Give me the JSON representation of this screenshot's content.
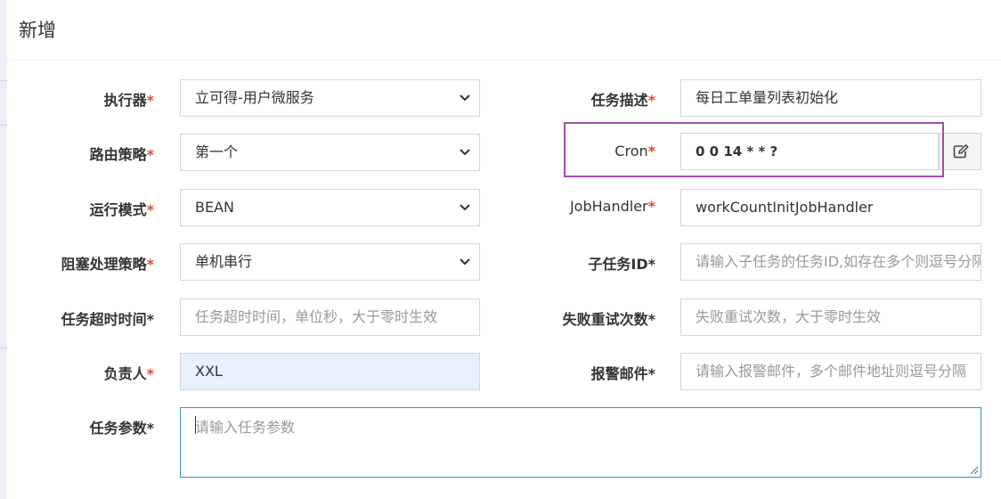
{
  "modal": {
    "title": "新增"
  },
  "form": {
    "executor": {
      "label": "执行器",
      "value": "立可得-用户微服务"
    },
    "route_strategy": {
      "label": "路由策略",
      "value": "第一个"
    },
    "run_mode": {
      "label": "运行模式",
      "value": "BEAN"
    },
    "block_strategy": {
      "label": "阻塞处理策略",
      "value": "单机串行"
    },
    "timeout": {
      "label": "任务超时时间",
      "placeholder": "任务超时时间，单位秒，大于零时生效"
    },
    "owner": {
      "label": "负责人",
      "value": "XXL"
    },
    "task_desc": {
      "label": "任务描述",
      "value": "每日工单量列表初始化"
    },
    "cron": {
      "label": "Cron",
      "value": "0 0 14 * * ?"
    },
    "job_handler": {
      "label": "JobHandler",
      "value": "workCountInitJobHandler"
    },
    "child_job_id": {
      "label": "子任务ID",
      "placeholder": "请输入子任务的任务ID,如存在多个则逗号分隔"
    },
    "retry_count": {
      "label": "失败重试次数",
      "placeholder": "失败重试次数，大于零时生效"
    },
    "alarm_email": {
      "label": "报警邮件",
      "placeholder": "请输入报警邮件，多个邮件地址则逗号分隔"
    },
    "task_param": {
      "label": "任务参数",
      "placeholder": "请输入任务参数"
    }
  },
  "required_marker": "*",
  "icons": {
    "select_chevron": "chevron-down-icon",
    "cron_edit": "edit-icon"
  },
  "colors": {
    "required": "#dd4b39",
    "focus_border": "#3c8dbc",
    "highlight": "#9b4fa8",
    "autofill": "#e8f0fe"
  }
}
